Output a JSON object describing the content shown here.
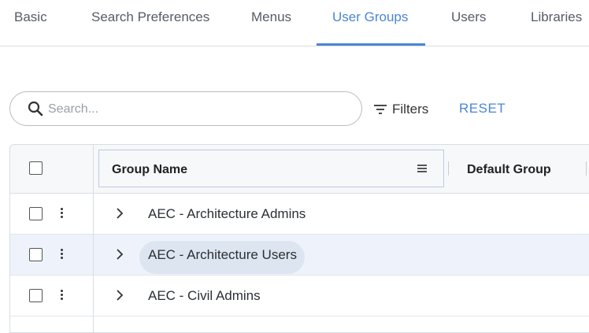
{
  "tabs": [
    {
      "label": "Basic"
    },
    {
      "label": "Search Preferences"
    },
    {
      "label": "Menus"
    },
    {
      "label": "User Groups"
    },
    {
      "label": "Users"
    },
    {
      "label": "Libraries"
    }
  ],
  "active_tab": "User Groups",
  "search": {
    "placeholder": "Search...",
    "icon": "search-icon"
  },
  "toolbar": {
    "filters_label": "Filters",
    "reset_label": "RESET"
  },
  "grid": {
    "columns": [
      {
        "label": "Group Name"
      },
      {
        "label": "Default Group"
      }
    ],
    "rows": [
      {
        "name": "AEC - Architecture Admins",
        "selected": false
      },
      {
        "name": "AEC - Architecture Users",
        "selected": true
      },
      {
        "name": "AEC - Civil Admins",
        "selected": false
      }
    ]
  },
  "colors": {
    "accent": "#4a86d4",
    "selected_row": "#eef3fb",
    "header_bg": "#f7f8fa"
  }
}
